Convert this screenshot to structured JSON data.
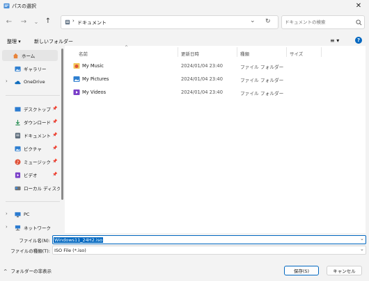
{
  "window": {
    "title": "パスの選択"
  },
  "address": {
    "path": "ドキュメント"
  },
  "search": {
    "placeholder": "ドキュメントの検索"
  },
  "toolbar": {
    "organize": "整理 ▾",
    "new_folder": "新しいフォルダー"
  },
  "sidebar": {
    "home": "ホーム",
    "gallery": "ギャラリー",
    "onedrive": "OneDrive",
    "desktop": "デスクトップ",
    "downloads": "ダウンロード",
    "documents": "ドキュメント",
    "pictures": "ピクチャ",
    "music": "ミュージック",
    "videos": "ビデオ",
    "localdisk": "ローカル ディスク (C",
    "pc": "PC",
    "network": "ネットワーク"
  },
  "columns": {
    "name": "名前",
    "modified": "更新日時",
    "type": "種類",
    "size": "サイズ"
  },
  "files": [
    {
      "name": "My Music",
      "modified": "2024/01/04 23:40",
      "type": "ファイル フォルダー"
    },
    {
      "name": "My Pictures",
      "modified": "2024/01/04 23:40",
      "type": "ファイル フォルダー"
    },
    {
      "name": "My Videos",
      "modified": "2024/01/04 23:40",
      "type": "ファイル フォルダー"
    }
  ],
  "filename": {
    "label": "ファイル名(N):",
    "value": "Windows11_24H2.iso"
  },
  "filetype": {
    "label": "ファイルの種類(T):",
    "value": "ISO File (*.iso)"
  },
  "footer": {
    "hide_folders": "フォルダーの非表示",
    "save": "保存(S)",
    "cancel": "キャンセル"
  },
  "colors": {
    "accent": "#0067c0",
    "selection": "#e5e5e5"
  }
}
